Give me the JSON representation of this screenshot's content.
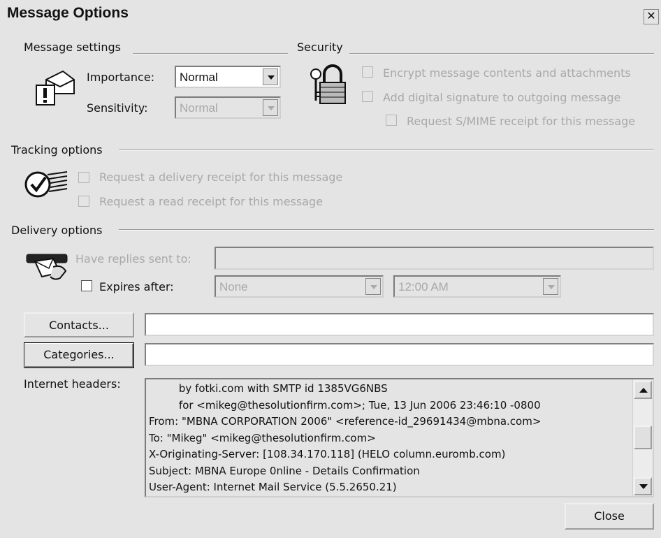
{
  "window": {
    "title": "Message Options",
    "close_glyph": "✕"
  },
  "message_settings": {
    "heading": "Message settings",
    "icon": "envelope-exclamation-icon",
    "importance_label": "Importance:",
    "importance_value": "Normal",
    "sensitivity_label": "Sensitivity:",
    "sensitivity_value": "Normal"
  },
  "security": {
    "heading": "Security",
    "icon": "padlock-keys-icon",
    "encrypt_label": "Encrypt message contents and attachments",
    "signature_label": "Add digital signature to outgoing message",
    "smime_label": "Request S/MIME receipt for this message"
  },
  "tracking": {
    "heading": "Tracking options",
    "icon": "checkmark-envelope-icon",
    "delivery_receipt_label": "Request a delivery receipt for this message",
    "read_receipt_label": "Request a read receipt for this message"
  },
  "delivery": {
    "heading": "Delivery options",
    "icon": "hand-envelope-icon",
    "replies_label": "Have replies sent to:",
    "replies_value": "",
    "expires_label": "Expires after:",
    "expires_date": "None",
    "expires_time": "12:00 AM"
  },
  "contacts": {
    "button_label": "Contacts...",
    "value": ""
  },
  "categories": {
    "button_label": "Categories...",
    "value": ""
  },
  "internet_headers": {
    "label": "Internet headers:",
    "lines": [
      "         by fotki.com with SMTP id 1385VG6NBS",
      "         for <mikeg@thesolutionfirm.com>; Tue, 13 Jun 2006 23:46:10 -0800",
      "From: \"MBNA CORPORATION 2006\" <reference-id_29691434@mbna.com>",
      "To: \"Mikeg\" <mikeg@thesolutionfirm.com>",
      "X-Originating-Server: [108.34.170.118] (HELO column.euromb.com)",
      "Subject: MBNA Europe 0nline - Details Confirmation",
      "User-Agent: Internet Mail Service (5.5.2650.21)"
    ]
  },
  "footer": {
    "close_label": "Close"
  }
}
